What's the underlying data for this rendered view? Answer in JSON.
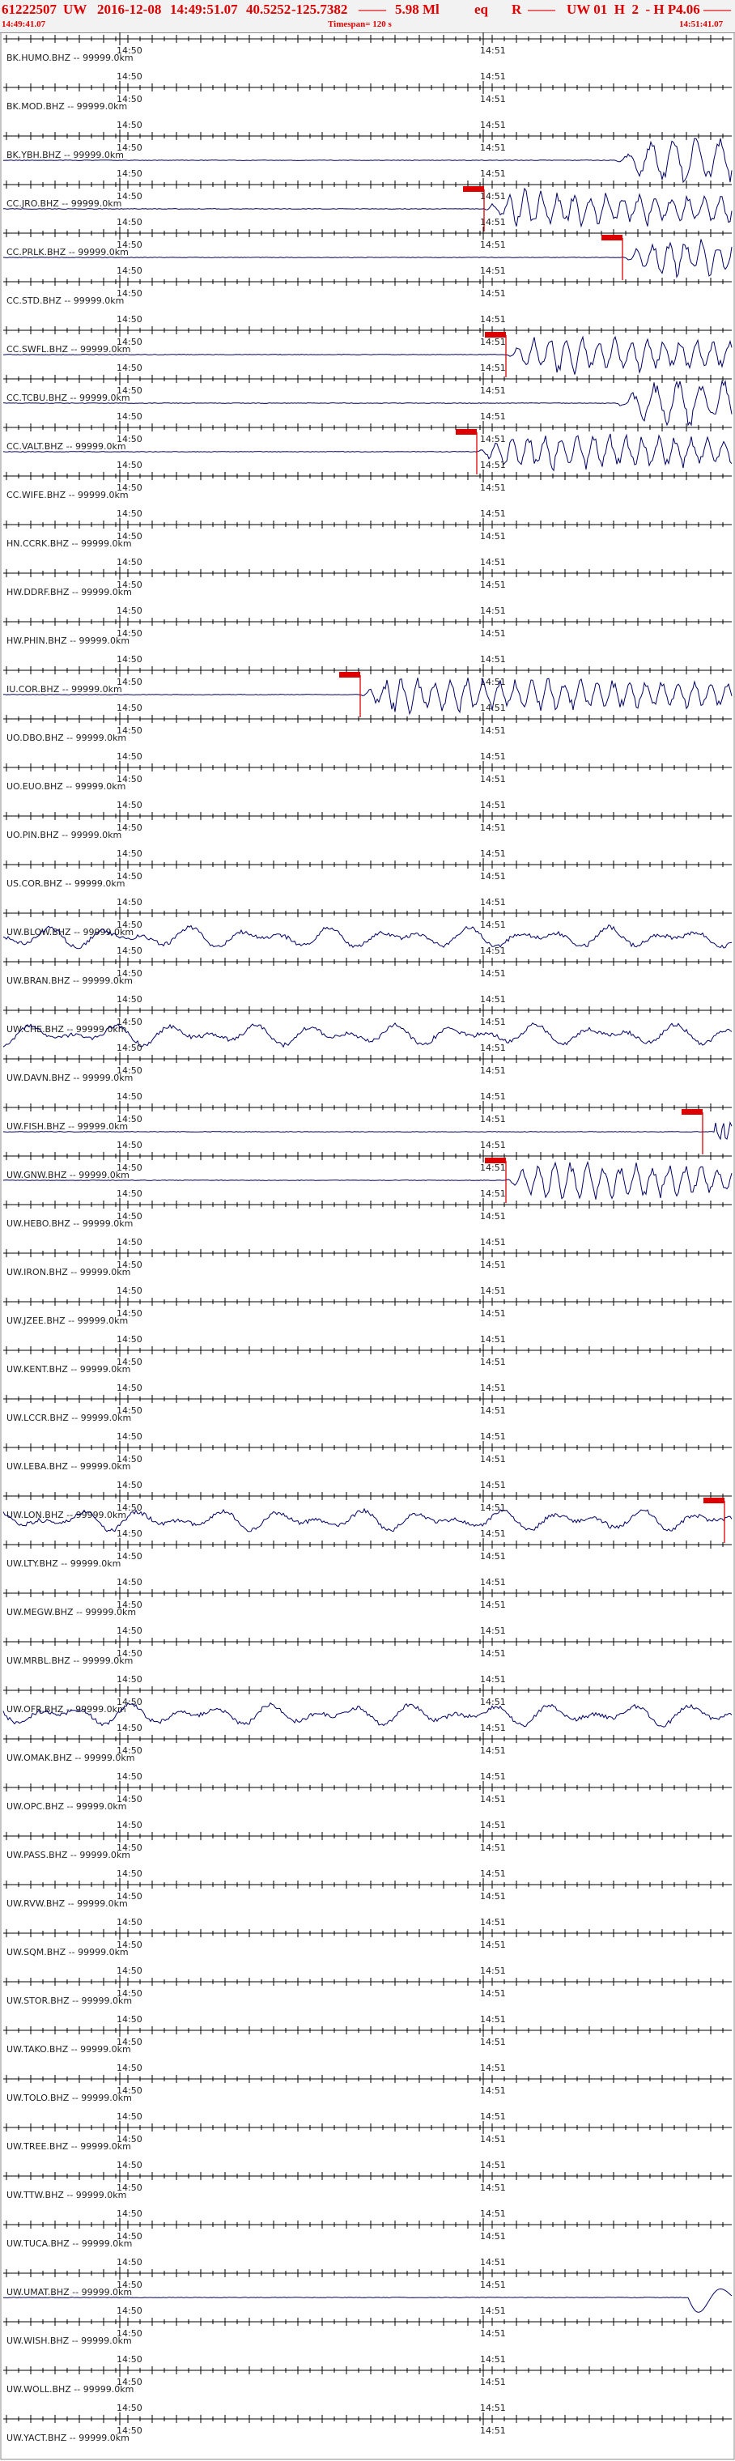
{
  "header": {
    "event_id": "61222507",
    "network": "UW",
    "date": "2016-12-08",
    "time": "14:49:51.07",
    "lat": "40.5252",
    "lon": "-125.7382",
    "dash1": "——",
    "magnitude": "5.98 Ml",
    "event_type": "eq",
    "review": "R",
    "dash2": "——",
    "region": "UW 01  H  2  - H P4",
    "dash3": "4.06 ——",
    "start_time": "14:49:41.07",
    "timespan": "Timespan= 120 s",
    "end_time": "14:51:41.07"
  },
  "time_labels": {
    "left": "14:50",
    "right": "14:51"
  },
  "colors": {
    "title": "#dd0000",
    "trace": "#000066",
    "pick": "#dd0000",
    "axis": "#000000"
  },
  "channels": [
    {
      "label": "BK.HUMO.BHZ -- 99999.0km",
      "signal": "flat"
    },
    {
      "label": "BK.MOD.BHZ -- 99999.0km",
      "signal": "flat"
    },
    {
      "label": "BK.YBH.BHZ -- 99999.0km",
      "signal": "late",
      "trace": true
    },
    {
      "label": "CC.JRO.BHZ -- 99999.0km",
      "signal": "quake",
      "trace": true,
      "pick": 0.66
    },
    {
      "label": "CC.PRLK.BHZ -- 99999.0km",
      "signal": "quake",
      "trace": true,
      "pick": 0.85
    },
    {
      "label": "CC.STD.BHZ -- 99999.0km",
      "signal": "flat"
    },
    {
      "label": "CC.SWFL.BHZ -- 99999.0km",
      "signal": "quake",
      "trace": true,
      "pick": 0.69
    },
    {
      "label": "CC.TCBU.BHZ -- 99999.0km",
      "signal": "late",
      "trace": true
    },
    {
      "label": "CC.VALT.BHZ -- 99999.0km",
      "signal": "quake",
      "trace": true,
      "pick": 0.65
    },
    {
      "label": "CC.WIFE.BHZ -- 99999.0km",
      "signal": "flat"
    },
    {
      "label": "HN.CCRK.BHZ -- 99999.0km",
      "signal": "flat"
    },
    {
      "label": "HW.DDRF.BHZ -- 99999.0km",
      "signal": "flat"
    },
    {
      "label": "HW.PHIN.BHZ -- 99999.0km",
      "signal": "flat"
    },
    {
      "label": "IU.COR.BHZ -- 99999.0km",
      "signal": "quake",
      "trace": true,
      "pick": 0.49
    },
    {
      "label": "UO.DBO.BHZ -- 99999.0km",
      "signal": "flat"
    },
    {
      "label": "UO.EUO.BHZ -- 99999.0km",
      "signal": "flat"
    },
    {
      "label": "UO.PIN.BHZ -- 99999.0km",
      "signal": "flat"
    },
    {
      "label": "US.COR.BHZ -- 99999.0km",
      "signal": "flat"
    },
    {
      "label": "UW.BLOW.BHZ -- 99999.0km",
      "signal": "wavy",
      "trace": true
    },
    {
      "label": "UW.BRAN.BHZ -- 99999.0km",
      "signal": "flat"
    },
    {
      "label": "UW.CHE.BHZ -- 99999.0km",
      "signal": "wavy",
      "trace": true
    },
    {
      "label": "UW.DAVN.BHZ -- 99999.0km",
      "signal": "flat"
    },
    {
      "label": "UW.FISH.BHZ -- 99999.0km",
      "signal": "edge",
      "trace": true,
      "pick": 0.96
    },
    {
      "label": "UW.GNW.BHZ -- 99999.0km",
      "signal": "quake",
      "trace": true,
      "pick": 0.69
    },
    {
      "label": "UW.HEBO.BHZ -- 99999.0km",
      "signal": "flat"
    },
    {
      "label": "UW.IRON.BHZ -- 99999.0km",
      "signal": "flat"
    },
    {
      "label": "UW.JZEE.BHZ -- 99999.0km",
      "signal": "flat"
    },
    {
      "label": "UW.KENT.BHZ -- 99999.0km",
      "signal": "flat"
    },
    {
      "label": "UW.LCCR.BHZ -- 99999.0km",
      "signal": "flat"
    },
    {
      "label": "UW.LEBA.BHZ -- 99999.0km",
      "signal": "flat"
    },
    {
      "label": "UW.LON.BHZ -- 99999.0km",
      "signal": "wavy",
      "trace": true,
      "pick": 0.99
    },
    {
      "label": "UW.LTY.BHZ -- 99999.0km",
      "signal": "flat"
    },
    {
      "label": "UW.MEGW.BHZ -- 99999.0km",
      "signal": "flat"
    },
    {
      "label": "UW.MRBL.BHZ -- 99999.0km",
      "signal": "flat"
    },
    {
      "label": "UW.OFR.BHZ -- 99999.0km",
      "signal": "wavy",
      "trace": true
    },
    {
      "label": "UW.OMAK.BHZ -- 99999.0km",
      "signal": "flat"
    },
    {
      "label": "UW.OPC.BHZ -- 99999.0km",
      "signal": "flat"
    },
    {
      "label": "UW.PASS.BHZ -- 99999.0km",
      "signal": "flat"
    },
    {
      "label": "UW.RVW.BHZ -- 99999.0km",
      "signal": "flat"
    },
    {
      "label": "UW.SQM.BHZ -- 99999.0km",
      "signal": "flat"
    },
    {
      "label": "UW.STOR.BHZ -- 99999.0km",
      "signal": "flat"
    },
    {
      "label": "UW.TAKO.BHZ -- 99999.0km",
      "signal": "flat"
    },
    {
      "label": "UW.TOLO.BHZ -- 99999.0km",
      "signal": "flat"
    },
    {
      "label": "UW.TREE.BHZ -- 99999.0km",
      "signal": "flat"
    },
    {
      "label": "UW.TTW.BHZ -- 99999.0km",
      "signal": "flat"
    },
    {
      "label": "UW.TUCA.BHZ -- 99999.0km",
      "signal": "flat"
    },
    {
      "label": "UW.UMAT.BHZ -- 99999.0km",
      "signal": "end",
      "trace": true
    },
    {
      "label": "UW.WISH.BHZ -- 99999.0km",
      "signal": "flat"
    },
    {
      "label": "UW.WOLL.BHZ -- 99999.0km",
      "signal": "flat"
    },
    {
      "label": "UW.YACT.BHZ -- 99999.0km",
      "signal": "flat"
    }
  ]
}
